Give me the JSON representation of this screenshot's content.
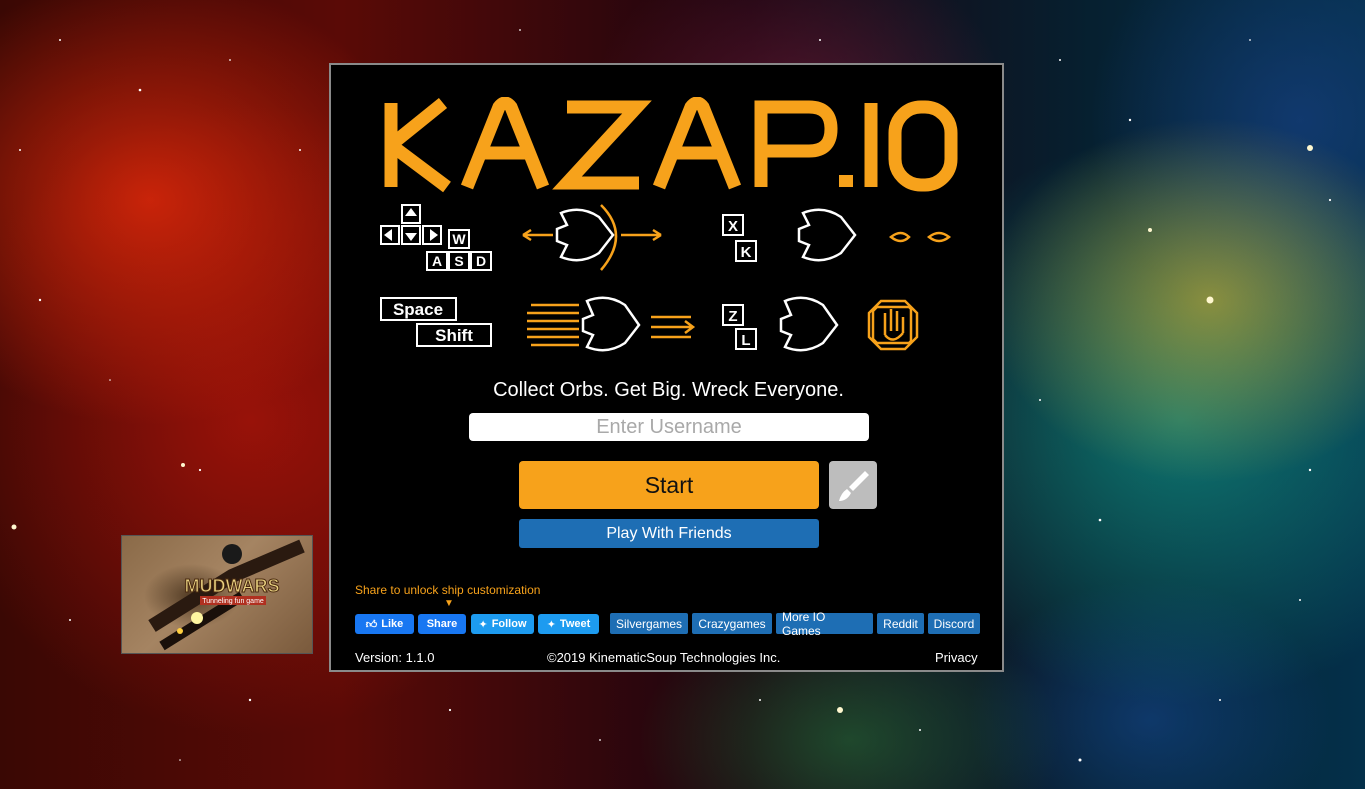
{
  "game": {
    "logo_text": "KAZAP.IO",
    "tagline": "Collect Orbs. Get Big. Wreck Everyone.",
    "username_placeholder": "Enter Username",
    "start_label": "Start",
    "play_friends_label": "Play With Friends",
    "share_note": "Share to unlock ship customization",
    "share_arrow": "▼"
  },
  "controls": {
    "move_keys": [
      "W",
      "A",
      "S",
      "D"
    ],
    "shoot_keys": [
      "X",
      "K"
    ],
    "boost_keys": [
      "Space",
      "Shift"
    ],
    "stop_keys": [
      "Z",
      "L"
    ]
  },
  "social": {
    "fb_like": "Like",
    "fb_share": "Share",
    "tw_follow": "Follow",
    "tw_tweet": "Tweet"
  },
  "links": [
    "Silvergames",
    "Crazygames",
    "More IO Games",
    "Reddit",
    "Discord"
  ],
  "footer": {
    "version": "Version: 1.1.0",
    "copyright": "©2019 KinematicSoup Technologies Inc.",
    "privacy": "Privacy"
  },
  "ad": {
    "title": "MUDWARS",
    "subtitle": "Tunneling fun game"
  },
  "colors": {
    "accent": "#f7a21b",
    "button_blue": "#1e6eb4",
    "panel_bg": "#000000"
  }
}
